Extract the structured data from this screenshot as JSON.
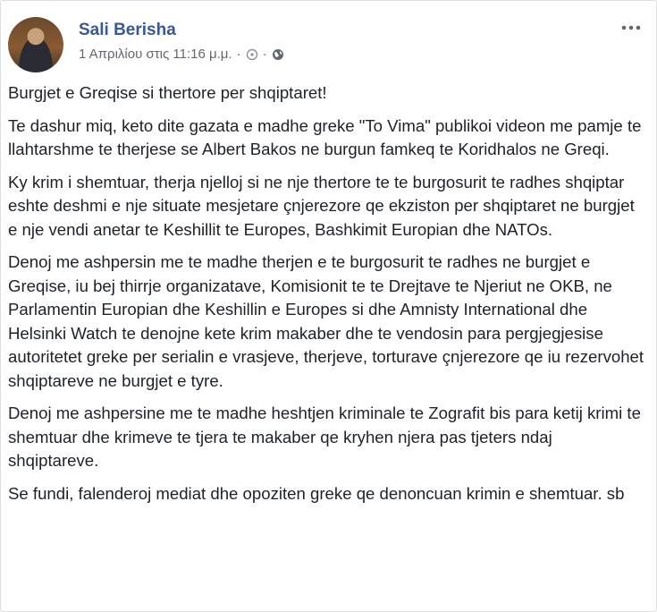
{
  "post": {
    "author": "Sali Berisha",
    "timestamp": "1 Απριλίου στις 11:16 μ.μ.",
    "separator": "·",
    "icons": {
      "settings": "gear-icon",
      "audience": "globe-icon",
      "more": "more-options-icon"
    },
    "paragraphs": [
      "Burgjet e Greqise si thertore per shqiptaret!",
      "Te dashur miq, keto dite gazata e madhe greke \"To Vima\" publikoi videon me pamje te llahtarshme te therjese se Albert Bakos ne burgun famkeq te Koridhalos ne Greqi.",
      "Ky krim i shemtuar, therja njelloj si ne nje thertore te te burgosurit te radhes shqiptar eshte deshmi e nje situate mesjetare çnjerezore qe ekziston per shqiptaret ne burgjet e nje vendi anetar te Keshillit te Europes, Bashkimit Europian dhe NATOs.",
      "Denoj me ashpersin me te madhe therjen e te burgosurit te radhes ne burgjet e Greqise, iu bej thirrje organizatave, Komisionit te te Drejtave te Njeriut ne OKB, ne Parlamentin Europian dhe Keshillin e Europes si dhe Amnisty International dhe Helsinki Watch te denojne kete krim makaber dhe te vendosin para pergjegjesise autoritetet greke per serialin e vrasjeve, therjeve, torturave çnjerezore qe iu rezervohet shqiptareve ne burgjet e tyre.",
      "Denoj me ashpersine me te madhe heshtjen kriminale te Zografit bis para ketij krimi te shemtuar dhe krimeve te tjera te makaber qe kryhen njera pas tjeters ndaj shqiptareve.",
      "Se fundi, falenderoj mediat dhe opoziten greke qe denoncuan krimin e shemtuar. sb"
    ]
  },
  "colors": {
    "author": "#385898",
    "meta": "#616770",
    "text": "#1d2129",
    "border": "#dddfe2"
  }
}
